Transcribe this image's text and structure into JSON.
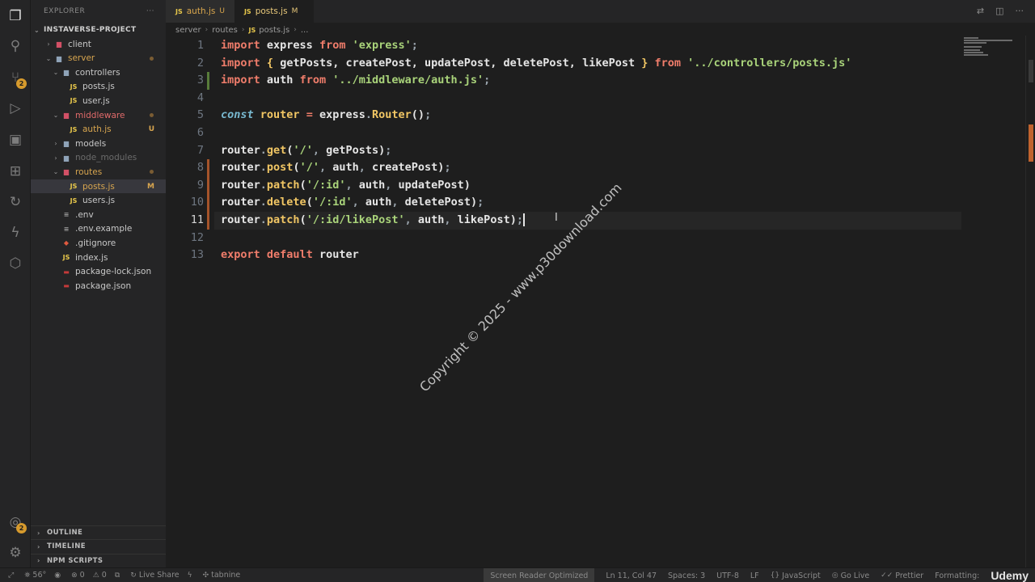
{
  "sidebar": {
    "title": "EXPLORER",
    "more": "···",
    "project": "INSTAVERSE-PROJECT",
    "tree": [
      {
        "label": "client",
        "icon": "folder",
        "chev": "›",
        "depth": 1,
        "kind": "redfolder"
      },
      {
        "label": "server",
        "icon": "folder",
        "chev": "⌄",
        "depth": 1,
        "kind": "folder",
        "state": "modified",
        "dot": true
      },
      {
        "label": "controllers",
        "icon": "folder",
        "chev": "⌄",
        "depth": 2,
        "kind": "folder"
      },
      {
        "label": "posts.js",
        "icon": "js",
        "depth": 3,
        "kind": "js"
      },
      {
        "label": "user.js",
        "icon": "js",
        "depth": 3,
        "kind": "js"
      },
      {
        "label": "middleware",
        "icon": "folder",
        "chev": "⌄",
        "depth": 2,
        "kind": "redfolder",
        "state": "untracked",
        "dot": true
      },
      {
        "label": "auth.js",
        "icon": "js",
        "depth": 3,
        "kind": "js",
        "state": "modified",
        "mark": "U"
      },
      {
        "label": "models",
        "icon": "folder",
        "chev": "›",
        "depth": 2,
        "kind": "folder"
      },
      {
        "label": "node_modules",
        "icon": "folder",
        "chev": "›",
        "depth": 2,
        "kind": "folder",
        "state": "dim"
      },
      {
        "label": "routes",
        "icon": "folder",
        "chev": "⌄",
        "depth": 2,
        "kind": "redfolder",
        "state": "modified",
        "dot": true
      },
      {
        "label": "posts.js",
        "icon": "js",
        "depth": 3,
        "kind": "js",
        "state": "modified",
        "mark": "M",
        "selected": true
      },
      {
        "label": "users.js",
        "icon": "js",
        "depth": 3,
        "kind": "js"
      },
      {
        "label": ".env",
        "icon": "file",
        "depth": 2,
        "kind": "plain"
      },
      {
        "label": ".env.example",
        "icon": "file",
        "depth": 2,
        "kind": "plain"
      },
      {
        "label": ".gitignore",
        "icon": "git",
        "depth": 2,
        "kind": "git"
      },
      {
        "label": "index.js",
        "icon": "js",
        "depth": 2,
        "kind": "js"
      },
      {
        "label": "package-lock.json",
        "icon": "npm",
        "depth": 2,
        "kind": "npm"
      },
      {
        "label": "package.json",
        "icon": "npm",
        "depth": 2,
        "kind": "npm"
      }
    ],
    "sections": [
      "OUTLINE",
      "TIMELINE",
      "NPM SCRIPTS"
    ]
  },
  "activity": {
    "scm_badge": "2",
    "account_badge": "2",
    "icons": [
      "files-icon",
      "search-icon",
      "source-control-icon",
      "run-debug-icon",
      "remote-explorer-icon",
      "extensions-icon",
      "live-share-icon",
      "thunder-client-icon",
      "docker-icon",
      "account-icon",
      "settings-gear-icon"
    ]
  },
  "tabs": [
    {
      "label": "auth.js",
      "status": "U",
      "active": false
    },
    {
      "label": "posts.js",
      "status": "M",
      "active": true
    }
  ],
  "breadcrumb": [
    "server",
    "routes",
    "posts.js",
    "..."
  ],
  "editor": {
    "current_line": 11,
    "lines": [
      {
        "n": "1",
        "tokens": [
          [
            "k",
            "import"
          ],
          [
            "t",
            " express "
          ],
          [
            "k",
            "from"
          ],
          [
            "t",
            " "
          ],
          [
            "s",
            "'express'"
          ],
          [
            "p",
            ";"
          ]
        ]
      },
      {
        "n": "2",
        "tokens": [
          [
            "k",
            "import"
          ],
          [
            "t",
            " "
          ],
          [
            "f",
            "{"
          ],
          [
            "t",
            " getPosts, createPost, updatePost, deletePost, likePost "
          ],
          [
            "f",
            "}"
          ],
          [
            "t",
            " "
          ],
          [
            "k",
            "from"
          ],
          [
            "t",
            " "
          ],
          [
            "s",
            "'../controllers/posts.js'"
          ]
        ]
      },
      {
        "n": "3",
        "tokens": [
          [
            "k",
            "import"
          ],
          [
            "t",
            " auth "
          ],
          [
            "k",
            "from"
          ],
          [
            "t",
            " "
          ],
          [
            "s",
            "'../middleware/auth.js'"
          ],
          [
            "p",
            ";"
          ]
        ],
        "gutter": "added"
      },
      {
        "n": "4",
        "tokens": []
      },
      {
        "n": "5",
        "tokens": [
          [
            "c",
            "const"
          ],
          [
            "t",
            " "
          ],
          [
            "f",
            "router"
          ],
          [
            "t",
            " "
          ],
          [
            "k",
            "="
          ],
          [
            "t",
            " express"
          ],
          [
            "p",
            "."
          ],
          [
            "f",
            "Router"
          ],
          [
            "t",
            "()"
          ],
          [
            "p",
            ";"
          ]
        ]
      },
      {
        "n": "6",
        "tokens": []
      },
      {
        "n": "7",
        "tokens": [
          [
            "t",
            "router"
          ],
          [
            "p",
            "."
          ],
          [
            "f",
            "get"
          ],
          [
            "t",
            "("
          ],
          [
            "s",
            "'/'"
          ],
          [
            "p",
            ","
          ],
          [
            "t",
            " getPosts)"
          ],
          [
            "p",
            ";"
          ]
        ]
      },
      {
        "n": "8",
        "tokens": [
          [
            "t",
            "router"
          ],
          [
            "p",
            "."
          ],
          [
            "f",
            "post"
          ],
          [
            "t",
            "("
          ],
          [
            "s",
            "'/'"
          ],
          [
            "p",
            ","
          ],
          [
            "t",
            " auth"
          ],
          [
            "p",
            ","
          ],
          [
            "t",
            " createPost)"
          ],
          [
            "p",
            ";"
          ]
        ],
        "gutter": "modified"
      },
      {
        "n": "9",
        "tokens": [
          [
            "t",
            "router"
          ],
          [
            "p",
            "."
          ],
          [
            "f",
            "patch"
          ],
          [
            "t",
            "("
          ],
          [
            "s",
            "'/:id'"
          ],
          [
            "p",
            ","
          ],
          [
            "t",
            " auth"
          ],
          [
            "p",
            ","
          ],
          [
            "t",
            " updatePost)"
          ]
        ],
        "gutter": "modified"
      },
      {
        "n": "10",
        "tokens": [
          [
            "t",
            "router"
          ],
          [
            "p",
            "."
          ],
          [
            "f",
            "delete"
          ],
          [
            "t",
            "("
          ],
          [
            "s",
            "'/:id'"
          ],
          [
            "p",
            ","
          ],
          [
            "t",
            " auth"
          ],
          [
            "p",
            ","
          ],
          [
            "t",
            " deletePost)"
          ],
          [
            "p",
            ";"
          ]
        ],
        "gutter": "modified"
      },
      {
        "n": "11",
        "tokens": [
          [
            "t",
            "router"
          ],
          [
            "p",
            "."
          ],
          [
            "f",
            "patch"
          ],
          [
            "t",
            "("
          ],
          [
            "s",
            "'/:id/likePost'"
          ],
          [
            "p",
            ","
          ],
          [
            "t",
            " auth"
          ],
          [
            "p",
            ","
          ],
          [
            "t",
            " likePost)"
          ],
          [
            "p",
            ";"
          ]
        ],
        "gutter": "modified",
        "cursor": true
      },
      {
        "n": "12",
        "tokens": []
      },
      {
        "n": "13",
        "tokens": [
          [
            "k",
            "export"
          ],
          [
            "t",
            " "
          ],
          [
            "k",
            "default"
          ],
          [
            "t",
            " router"
          ]
        ]
      }
    ]
  },
  "watermark": "Copyright © 2025 - www.p30download.com",
  "statusbar": {
    "left": [
      {
        "icon": "remote-icon",
        "glyph": "⤢",
        "text": ""
      },
      {
        "icon": "ports-icon",
        "glyph": "⛯",
        "text": "56°"
      },
      {
        "icon": "eye-icon",
        "glyph": "◉",
        "text": ""
      },
      {
        "icon": "errors-icon",
        "glyph": "⊗",
        "text": "0"
      },
      {
        "icon": "warnings-icon",
        "glyph": "⚠",
        "text": "0"
      },
      {
        "icon": "terminal-icon",
        "glyph": "⧉",
        "text": ""
      },
      {
        "icon": "live-share-status-icon",
        "glyph": "↻",
        "text": "Live Share"
      },
      {
        "icon": "bolt-icon",
        "glyph": "ϟ",
        "text": ""
      },
      {
        "icon": "tabnine-icon",
        "glyph": "✣",
        "text": "tabnine"
      }
    ],
    "right": [
      {
        "text": "Screen Reader Optimized",
        "highlight": true
      },
      {
        "text": "Ln 11, Col 47"
      },
      {
        "text": "Spaces: 3"
      },
      {
        "text": "UTF-8"
      },
      {
        "text": "LF"
      },
      {
        "text": "JavaScript",
        "glyph": "{}"
      },
      {
        "text": "Go Live",
        "glyph": "◎"
      },
      {
        "text": "Prettier",
        "glyph": "✓✓"
      },
      {
        "text": "Formatting:",
        "glyph": ""
      }
    ],
    "brand": "Udemy"
  }
}
